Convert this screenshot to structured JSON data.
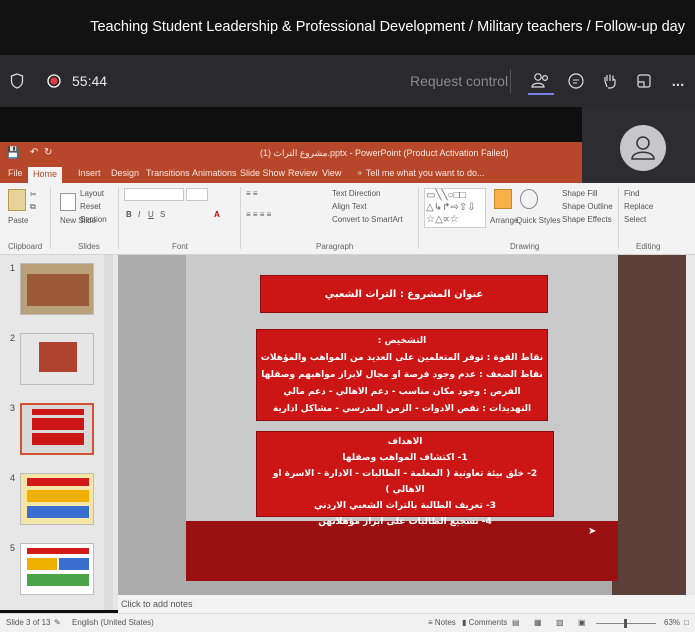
{
  "meeting": {
    "title": "Teaching Student Leadership & Professional Development / Military teachers / Follow-up day",
    "timer": "55:44",
    "request_control": "Request control",
    "more": "..."
  },
  "ppt": {
    "title": "مشروع التراث (1).pptx - PowerPoint (Product Activation Failed)",
    "tabs": [
      "File",
      "Home",
      "Insert",
      "Design",
      "Transitions",
      "Animations",
      "Slide Show",
      "Review",
      "View",
      "Tell me what you want to do..."
    ],
    "ribbon": {
      "paste": "Paste",
      "new_slide": "New Slide",
      "layout": "Layout",
      "reset": "Reset",
      "section": "Section",
      "text_direction": "Text Direction",
      "align_text": "Align Text",
      "convert_smartart": "Convert to SmartArt",
      "arrange": "Arrange",
      "quick_styles": "Quick Styles",
      "shape_fill": "Shape Fill",
      "shape_outline": "Shape Outline",
      "shape_effects": "Shape Effects",
      "find": "Find",
      "replace": "Replace",
      "select": "Select",
      "groups": {
        "clipboard": "Clipboard",
        "slides": "Slides",
        "font": "Font",
        "paragraph": "Paragraph",
        "drawing": "Drawing",
        "editing": "Editing"
      }
    },
    "thumbs": [
      "1",
      "2",
      "3",
      "4",
      "5"
    ],
    "slide": {
      "title": "عنوان المشروع : التراث الشعبي",
      "diag": [
        "التشخيص :",
        "نقاط القوة : توفر المتعلمين على العديد من المواهب والمؤهلات",
        "نقاط الضعف : عدم وجود فرصة او مجال لابراز مواهبهم وصقلها",
        "الفرص : وجود مكان مناسب - دعم الاهالي - دعم مالي",
        "التهديدات : نقص الادوات - الزمن المدرسي - مشاكل ادارية"
      ],
      "goals": [
        "الاهداف",
        "1- اكتشاف المواهب وصقلها",
        "2- خلق بيئة تعاونية ( المعلمة - الطالبات - الادارة - الاسرة او الاهالي )",
        "3- تعريف الطالبة بالتراث الشعبي الاردني",
        "4- تشجيع الطالبات على ابراز مؤهلاتهن"
      ]
    },
    "notes_placeholder": "Click to add notes",
    "status": {
      "slide": "Slide 3 of 13",
      "language": "English (United States)",
      "notes": "Notes",
      "comments": "Comments",
      "zoom": "63%"
    }
  }
}
